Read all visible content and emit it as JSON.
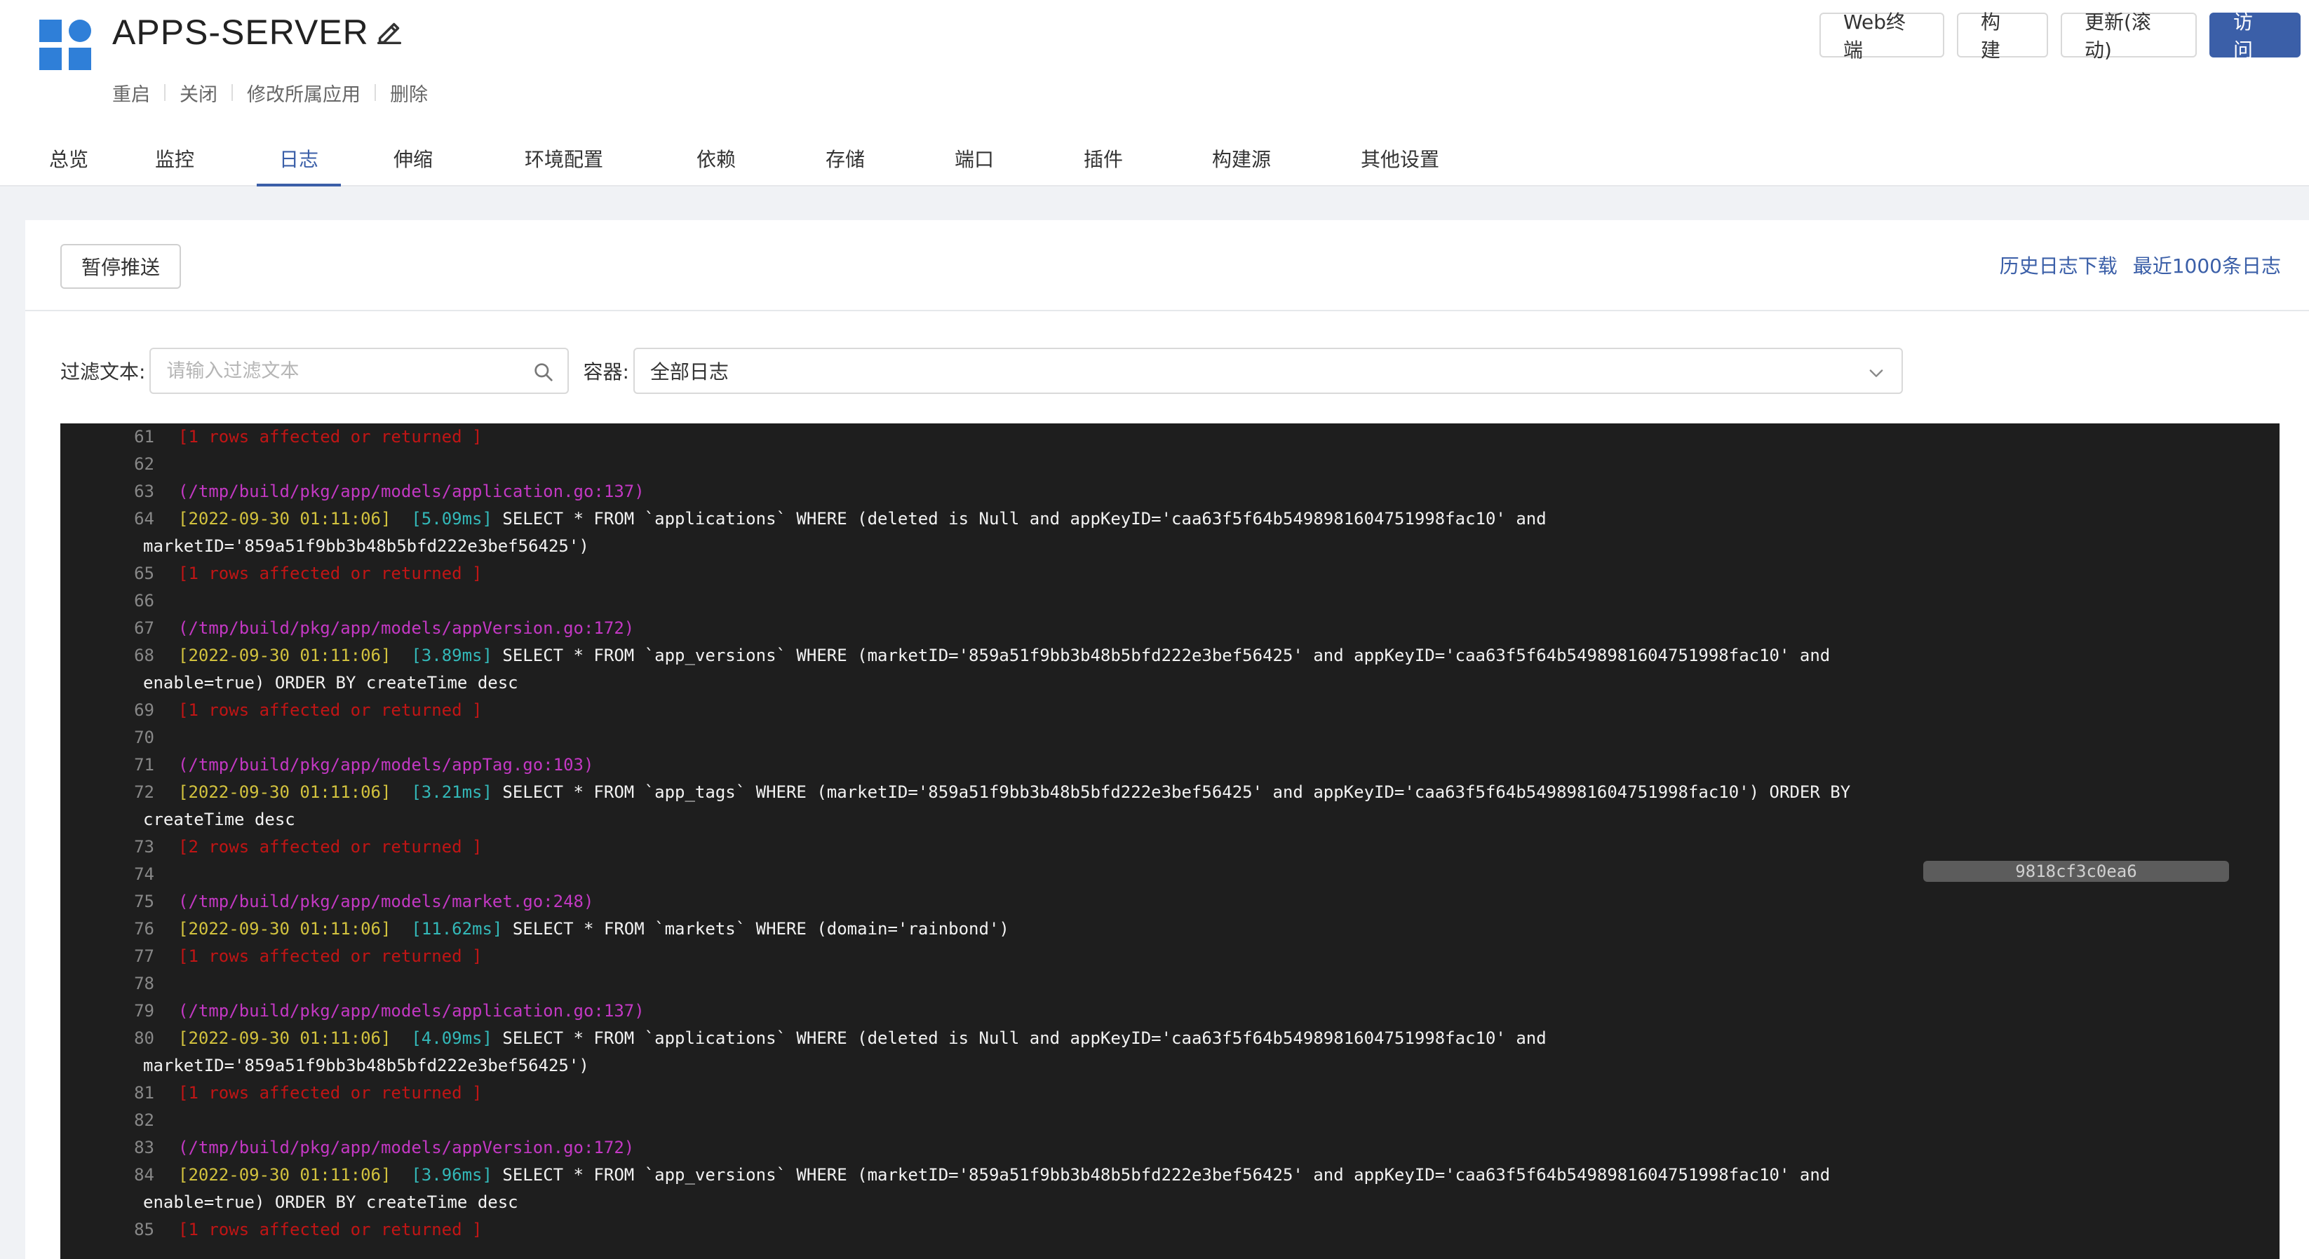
{
  "app": {
    "title": "APPS-SERVER",
    "logo_icon": "grid-logo-icon",
    "actions": [
      "重启",
      "关闭",
      "修改所属应用",
      "删除"
    ]
  },
  "top_buttons": {
    "web_terminal": "Web终端",
    "build": "构 建",
    "update_rolling": "更新(滚动)",
    "visit": "访 问"
  },
  "tabs": [
    {
      "label": "总览",
      "active": false
    },
    {
      "label": "监控",
      "active": false
    },
    {
      "label": "日志",
      "active": true
    },
    {
      "label": "伸缩",
      "active": false
    },
    {
      "label": "环境配置",
      "active": false
    },
    {
      "label": "依赖",
      "active": false
    },
    {
      "label": "存储",
      "active": false
    },
    {
      "label": "端口",
      "active": false
    },
    {
      "label": "插件",
      "active": false
    },
    {
      "label": "构建源",
      "active": false
    },
    {
      "label": "其他设置",
      "active": false
    }
  ],
  "log_panel": {
    "pause_button": "暂停推送",
    "history_download": "历史日志下载",
    "last_1000": "最近1000条日志",
    "filter_label": "过滤文本:",
    "filter_placeholder": "请输入过滤文本",
    "container_label": "容器:",
    "container_value": "全部日志",
    "hash_badge": "9818cf3c0ea6"
  },
  "log_lines": {
    "l61": {
      "num": "61",
      "rows": "[1 rows affected or returned ]"
    },
    "l62": {
      "num": "62"
    },
    "l63": {
      "num": "63",
      "path": "(/tmp/build/pkg/app/models/application.go:137)"
    },
    "l64": {
      "num": "64",
      "time": "[2022-09-30 01:11:06]",
      "dur": "[5.09ms]",
      "sql": "SELECT * FROM `applications` WHERE (deleted is Null and appKeyID='caa63f5f64b5498981604751998fac10' and",
      "cont": "marketID='859a51f9bb3b48b5bfd222e3bef56425')"
    },
    "l65": {
      "num": "65",
      "rows": "[1 rows affected or returned ]"
    },
    "l66": {
      "num": "66"
    },
    "l67": {
      "num": "67",
      "path": "(/tmp/build/pkg/app/models/appVersion.go:172)"
    },
    "l68": {
      "num": "68",
      "time": "[2022-09-30 01:11:06]",
      "dur": "[3.89ms]",
      "sql": "SELECT * FROM `app_versions` WHERE (marketID='859a51f9bb3b48b5bfd222e3bef56425' and appKeyID='caa63f5f64b5498981604751998fac10' and",
      "cont": "enable=true) ORDER BY createTime desc"
    },
    "l69": {
      "num": "69",
      "rows": "[1 rows affected or returned ]"
    },
    "l70": {
      "num": "70"
    },
    "l71": {
      "num": "71",
      "path": "(/tmp/build/pkg/app/models/appTag.go:103)"
    },
    "l72": {
      "num": "72",
      "time": "[2022-09-30 01:11:06]",
      "dur": "[3.21ms]",
      "sql": "SELECT * FROM `app_tags` WHERE (marketID='859a51f9bb3b48b5bfd222e3bef56425' and appKeyID='caa63f5f64b5498981604751998fac10') ORDER BY",
      "cont": "createTime desc"
    },
    "l73": {
      "num": "73",
      "rows": "[2 rows affected or returned ]"
    },
    "l74": {
      "num": "74"
    },
    "l75": {
      "num": "75",
      "path": "(/tmp/build/pkg/app/models/market.go:248)"
    },
    "l76": {
      "num": "76",
      "time": "[2022-09-30 01:11:06]",
      "dur": "[11.62ms]",
      "sql": "SELECT * FROM `markets` WHERE (domain='rainbond')"
    },
    "l77": {
      "num": "77",
      "rows": "[1 rows affected or returned ]"
    },
    "l78": {
      "num": "78"
    },
    "l79": {
      "num": "79",
      "path": "(/tmp/build/pkg/app/models/application.go:137)"
    },
    "l80": {
      "num": "80",
      "time": "[2022-09-30 01:11:06]",
      "dur": "[4.09ms]",
      "sql": "SELECT * FROM `applications` WHERE (deleted is Null and appKeyID='caa63f5f64b5498981604751998fac10' and",
      "cont": "marketID='859a51f9bb3b48b5bfd222e3bef56425')"
    },
    "l81": {
      "num": "81",
      "rows": "[1 rows affected or returned ]"
    },
    "l82": {
      "num": "82"
    },
    "l83": {
      "num": "83",
      "path": "(/tmp/build/pkg/app/models/appVersion.go:172)"
    },
    "l84": {
      "num": "84",
      "time": "[2022-09-30 01:11:06]",
      "dur": "[3.96ms]",
      "sql": "SELECT * FROM `app_versions` WHERE (marketID='859a51f9bb3b48b5bfd222e3bef56425' and appKeyID='caa63f5f64b5498981604751998fac10' and",
      "cont": "enable=true) ORDER BY createTime desc"
    },
    "l85": {
      "num": "85",
      "rows": "[1 rows affected or returned ]"
    }
  },
  "colors": {
    "accent": "#3b5fa8",
    "logo": "#2f7fd8",
    "console_bg": "#1e1e1e",
    "log_path": "#c338c3",
    "log_time": "#d2c23e",
    "log_duration": "#33b8b8",
    "log_rows": "#c01515"
  }
}
